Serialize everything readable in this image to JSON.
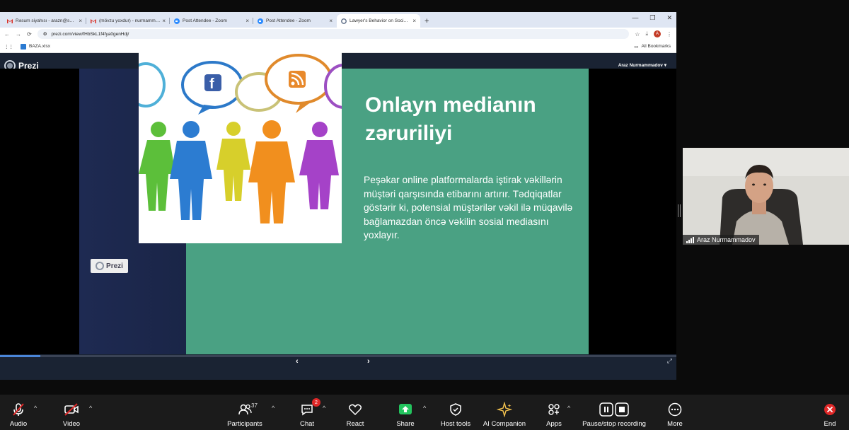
{
  "browser": {
    "tabs": [
      {
        "label": "Rəsum siyahısı - arazn@soltio...",
        "icon": "gmail-icon",
        "active": false
      },
      {
        "label": "(mövzu yoxdur) - nurmammad...",
        "icon": "gmail-icon",
        "active": false
      },
      {
        "label": "Post Attendee - Zoom",
        "icon": "zoom-icon",
        "active": false
      },
      {
        "label": "Post Attendee - Zoom",
        "icon": "zoom-icon",
        "active": false
      },
      {
        "label": "Lawyer's Behavior on Social M...",
        "icon": "prezi-icon",
        "active": true
      }
    ],
    "url": "prezi.com/view/fHbSkL1f4fya0genHdj/",
    "bookmark": "BAZA.xlsx",
    "all_bookmarks": "All Bookmarks",
    "profile_initial": "A"
  },
  "prezi": {
    "logo": "Prezi",
    "user": "Araz Nurmammadov",
    "badge": "Prezi",
    "progress_percent": 6
  },
  "slide": {
    "title": "Onlayn medianın zəruriliyi",
    "body": "Peşəkar online platformalarda iştirak vəkillərin müştəri qarşısında etibarını artırır. Tədqiqatlar göstərir ki, potensial müştərilər vəkil ilə müqavilə bağlamazdan öncə vəkilin sosial mediasını yoxlayır."
  },
  "participant": {
    "name": "Araz Nurmammadov"
  },
  "toolbar": {
    "audio": "Audio",
    "video": "Video",
    "participants": "Participants",
    "participants_count": "37",
    "chat": "Chat",
    "chat_badge": "2",
    "react": "React",
    "share": "Share",
    "host_tools": "Host tools",
    "ai_companion": "AI Companion",
    "apps": "Apps",
    "recording": "Pause/stop recording",
    "more": "More",
    "end": "End"
  },
  "colors": {
    "slide_green": "#4aa183",
    "slide_navy": "#1e2a52",
    "share_green": "#23c45e",
    "end_red": "#e02828"
  }
}
